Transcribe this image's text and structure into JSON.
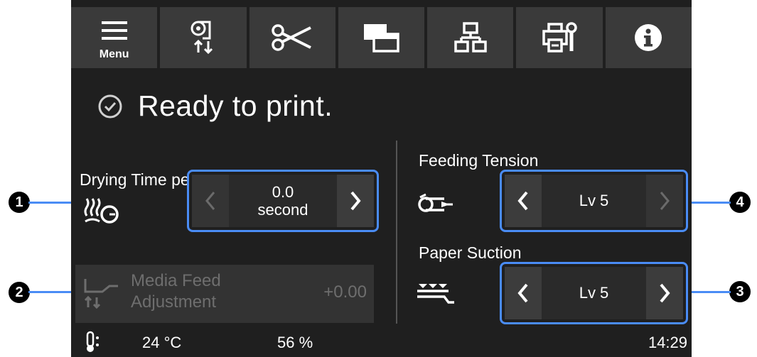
{
  "toolbar": {
    "menu_label": "Menu",
    "buttons": [
      "menu-icon",
      "paper-feed-icon",
      "cut-icon",
      "window-icon",
      "network-icon",
      "maintenance-icon",
      "info-icon"
    ]
  },
  "status": {
    "text": "Ready to print."
  },
  "left_panel": {
    "drying_label": "Drying Time per Pass",
    "drying_value_line1": "0.0",
    "drying_value_line2": "second",
    "media_feed_label_line1": "Media Feed",
    "media_feed_label_line2": "Adjustment",
    "media_feed_value": "+0.00"
  },
  "right_panel": {
    "feeding_label": "Feeding Tension",
    "feeding_value": "Lv 5",
    "suction_label": "Paper Suction",
    "suction_value": "Lv 5"
  },
  "bottom_bar": {
    "temperature": "24 °C",
    "humidity": "56 %",
    "time": "14:29"
  },
  "callouts": [
    "1",
    "2",
    "3",
    "4"
  ],
  "colors": {
    "screen_bg": "#1f1f1f",
    "button_bg": "#3a3a3a",
    "highlight": "#4a8cf5"
  }
}
